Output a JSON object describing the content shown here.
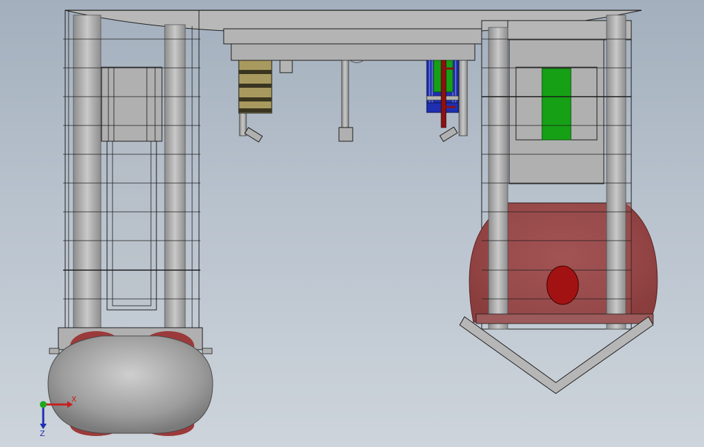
{
  "viewport": {
    "background_top": "#a3afbd",
    "background_bottom": "#cdd4db"
  },
  "model": {
    "body_color": "#b4b4b4",
    "edge_color": "#1a1a1a",
    "tank_color": "#9b4a4a",
    "tank_dark": "#8a1212",
    "green_part": "#16a016",
    "tan_part": "#a89a5e",
    "blue_part": "#1e2fb0"
  },
  "triad": {
    "x_label": "X",
    "z_label": "Z",
    "x_color": "#c81e1e",
    "z_color": "#1e2fb0",
    "y_color": "#1fa81f"
  }
}
